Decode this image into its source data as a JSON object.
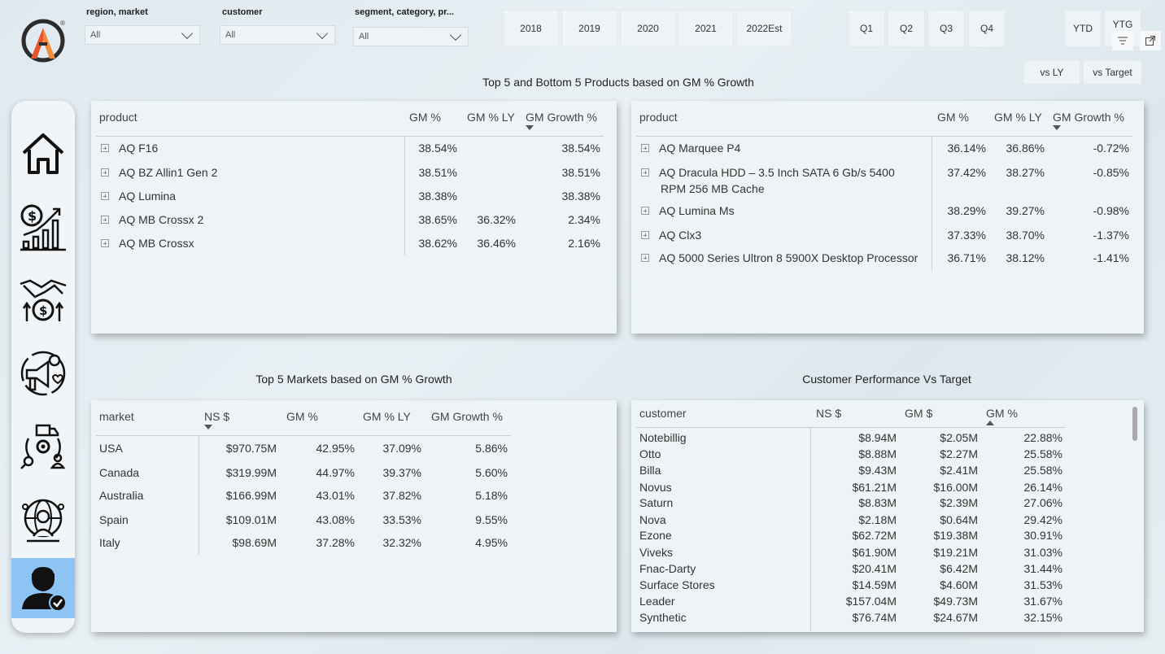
{
  "filters": [
    {
      "label": "region, market",
      "value": "All"
    },
    {
      "label": "customer",
      "value": "All"
    },
    {
      "label": "segment, category, pr...",
      "value": "All"
    }
  ],
  "years": [
    "2018",
    "2019",
    "2020",
    "2021",
    "2022Est"
  ],
  "quarters": [
    "Q1",
    "Q2",
    "Q3",
    "Q4"
  ],
  "period": {
    "ytd": "YTD",
    "ytg": "YTG"
  },
  "compare": {
    "vs_ly": "vs LY",
    "vs_target": "vs Target"
  },
  "titles": {
    "products": "Top 5 and Bottom 5 Products based on GM % Growth",
    "markets": "Top 5 Markets based on GM % Growth",
    "customers": "Customer Performance Vs Target"
  },
  "top_products": {
    "headers": {
      "product": "product",
      "gm": "GM %",
      "gm_ly": "GM % LY",
      "growth": "GM Growth %"
    },
    "rows": [
      {
        "product": "AQ F16",
        "gm": "38.54%",
        "gm_ly": "",
        "growth": "38.54%"
      },
      {
        "product": "AQ BZ Allin1 Gen 2",
        "gm": "38.51%",
        "gm_ly": "",
        "growth": "38.51%"
      },
      {
        "product": "AQ Lumina",
        "gm": "38.38%",
        "gm_ly": "",
        "growth": "38.38%"
      },
      {
        "product": "AQ MB Crossx 2",
        "gm": "38.65%",
        "gm_ly": "36.32%",
        "growth": "2.34%"
      },
      {
        "product": "AQ MB Crossx",
        "gm": "38.62%",
        "gm_ly": "36.46%",
        "growth": "2.16%"
      }
    ]
  },
  "bottom_products": {
    "headers": {
      "product": "product",
      "gm": "GM %",
      "gm_ly": "GM % LY",
      "growth": "GM Growth %"
    },
    "rows": [
      {
        "product": "AQ Marquee P4",
        "product2": "",
        "gm": "36.14%",
        "gm_ly": "36.86%",
        "growth": "-0.72%"
      },
      {
        "product": "AQ Dracula HDD – 3.5 Inch SATA 6 Gb/s 5400",
        "product2": "RPM 256 MB Cache",
        "gm": "37.42%",
        "gm_ly": "38.27%",
        "growth": "-0.85%"
      },
      {
        "product": "AQ Lumina Ms",
        "product2": "",
        "gm": "38.29%",
        "gm_ly": "39.27%",
        "growth": "-0.98%"
      },
      {
        "product": "AQ Clx3",
        "product2": "",
        "gm": "37.33%",
        "gm_ly": "38.70%",
        "growth": "-1.37%"
      },
      {
        "product": "AQ 5000 Series Ultron 8 5900X Desktop Processor",
        "product2": "",
        "gm": "36.71%",
        "gm_ly": "38.12%",
        "growth": "-1.41%"
      }
    ]
  },
  "markets": {
    "headers": {
      "market": "market",
      "ns": "NS $",
      "gm": "GM %",
      "gm_ly": "GM % LY",
      "growth": "GM Growth %"
    },
    "rows": [
      {
        "market": "USA",
        "ns": "$970.75M",
        "gm": "42.95%",
        "gm_ly": "37.09%",
        "growth": "5.86%"
      },
      {
        "market": "Canada",
        "ns": "$319.99M",
        "gm": "44.97%",
        "gm_ly": "39.37%",
        "growth": "5.60%"
      },
      {
        "market": "Australia",
        "ns": "$166.99M",
        "gm": "43.01%",
        "gm_ly": "37.82%",
        "growth": "5.18%"
      },
      {
        "market": "Spain",
        "ns": "$109.01M",
        "gm": "43.08%",
        "gm_ly": "33.53%",
        "growth": "9.55%"
      },
      {
        "market": "Italy",
        "ns": "$98.69M",
        "gm": "37.28%",
        "gm_ly": "32.32%",
        "growth": "4.95%"
      }
    ]
  },
  "customers": {
    "headers": {
      "customer": "customer",
      "ns": "NS $",
      "gm_dollar": "GM $",
      "gm_pct": "GM %"
    },
    "rows": [
      {
        "customer": "Notebillig",
        "ns": "$8.94M",
        "gm_dollar": "$2.05M",
        "gm_pct": "22.88%"
      },
      {
        "customer": "Otto",
        "ns": "$8.88M",
        "gm_dollar": "$2.27M",
        "gm_pct": "25.58%"
      },
      {
        "customer": "Billa",
        "ns": "$9.43M",
        "gm_dollar": "$2.41M",
        "gm_pct": "25.58%"
      },
      {
        "customer": "Novus",
        "ns": "$61.21M",
        "gm_dollar": "$16.00M",
        "gm_pct": "26.14%"
      },
      {
        "customer": "Saturn",
        "ns": "$8.83M",
        "gm_dollar": "$2.39M",
        "gm_pct": "27.06%"
      },
      {
        "customer": "Nova",
        "ns": "$2.18M",
        "gm_dollar": "$0.64M",
        "gm_pct": "29.42%"
      },
      {
        "customer": "Ezone",
        "ns": "$62.72M",
        "gm_dollar": "$19.38M",
        "gm_pct": "30.91%"
      },
      {
        "customer": "Viveks",
        "ns": "$61.90M",
        "gm_dollar": "$19.21M",
        "gm_pct": "31.03%"
      },
      {
        "customer": "Fnac-Darty",
        "ns": "$20.41M",
        "gm_dollar": "$6.42M",
        "gm_pct": "31.44%"
      },
      {
        "customer": "Surface Stores",
        "ns": "$14.59M",
        "gm_dollar": "$4.60M",
        "gm_pct": "31.53%"
      },
      {
        "customer": "Leader",
        "ns": "$157.04M",
        "gm_dollar": "$49.73M",
        "gm_pct": "31.67%"
      },
      {
        "customer": "Synthetic",
        "ns": "$76.74M",
        "gm_dollar": "$24.67M",
        "gm_pct": "32.15%"
      }
    ]
  },
  "sidebar": {
    "items": [
      {
        "icon": "home-icon"
      },
      {
        "icon": "finance-growth-icon"
      },
      {
        "icon": "handshake-money-icon"
      },
      {
        "icon": "marketing-megaphone-icon"
      },
      {
        "icon": "supply-chain-icon"
      },
      {
        "icon": "global-user-icon"
      },
      {
        "icon": "user-check-icon"
      }
    ],
    "active_index": 6
  },
  "colors": {
    "accent_orange": "#e8532b",
    "active_nav": "#8dc4f4",
    "panel": "#eef3f6"
  }
}
